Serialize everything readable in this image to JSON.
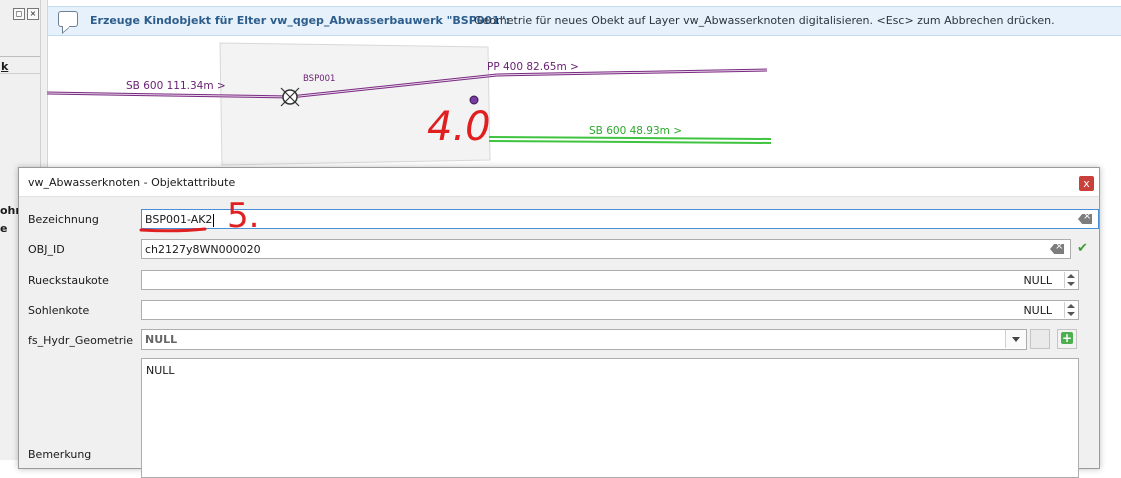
{
  "message_bar": {
    "title": "Erzeuge Kindobjekt für Elter vw_qgep_Abwasserbauwerk \"BSP001\":",
    "text": "Geometrie für neues Obekt auf Layer vw_Abwasserknoten digitalisieren. <Esc> zum Abbrechen drücken."
  },
  "left_panel": {
    "frag_k": "k",
    "frag_ohr": "ohr",
    "frag_e": "e"
  },
  "map": {
    "line_sb600_left": "SB 600 111.34m >",
    "node_label": "BSP001",
    "line_pp400": "PP 400 82.65m >",
    "line_sb600_right": "SB 600 48.93m >",
    "annotation_step4": "4.0",
    "colors": {
      "purple_line": "#7a2a82",
      "green_line": "#3fc43f",
      "annotation_red": "#e02020"
    }
  },
  "dialog": {
    "title": "vw_Abwasserknoten - Objektattribute",
    "close_label": "x",
    "annotation_step5": "5.",
    "fields": {
      "bezeichnung": {
        "label": "Bezeichnung",
        "value": "BSP001-AK2"
      },
      "obj_id": {
        "label": "OBJ_ID",
        "value": "ch2127y8WN000020"
      },
      "rueckstaukote": {
        "label": "Rueckstaukote",
        "value": "NULL"
      },
      "sohlenkote": {
        "label": "Sohlenkote",
        "value": "NULL"
      },
      "fs_hydr_geometrie": {
        "label": "fs_Hydr_Geometrie",
        "value": "NULL"
      },
      "bemerkung": {
        "label": "Bemerkung",
        "value": "NULL"
      }
    }
  }
}
